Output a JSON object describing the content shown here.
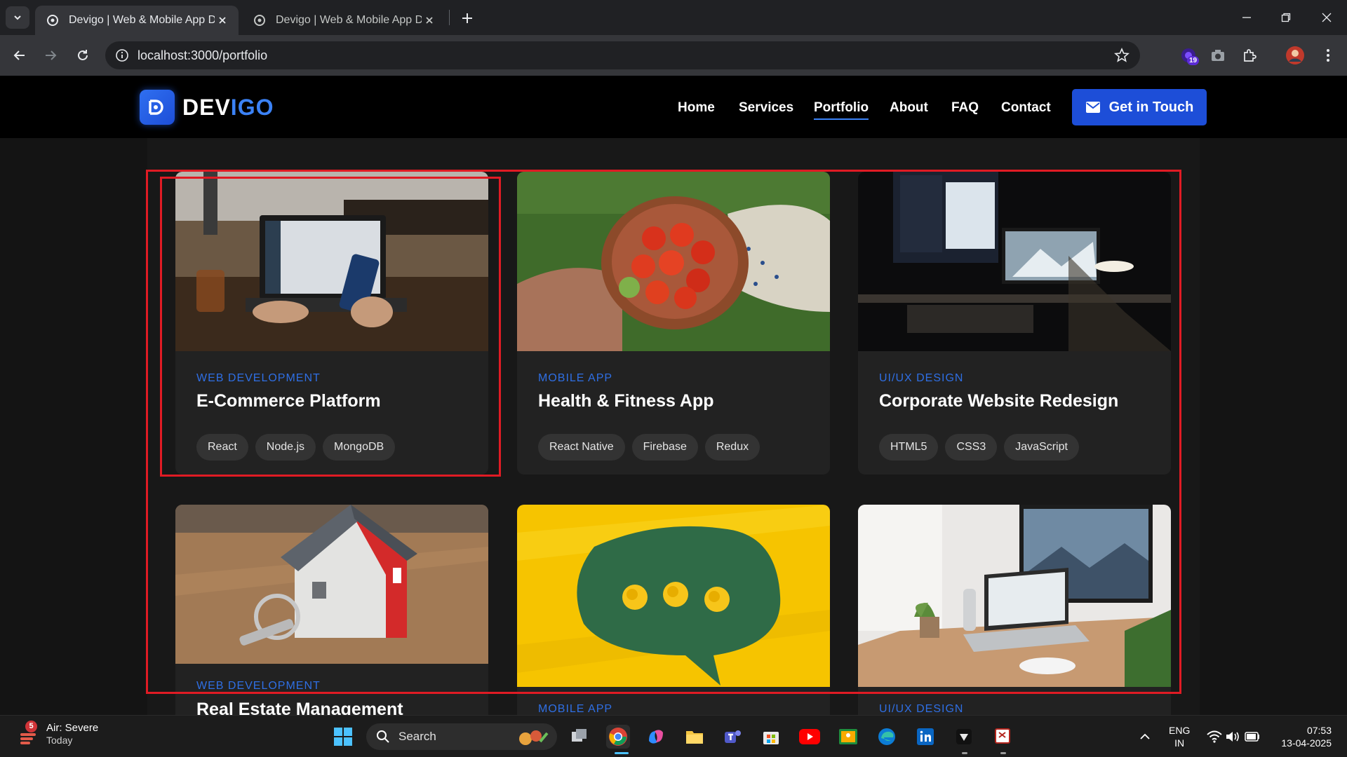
{
  "browser": {
    "tabs": [
      {
        "title": "Devigo | Web & Mobile App Development",
        "active": true
      },
      {
        "title": "Devigo | Web & Mobile App Development",
        "active": false
      }
    ],
    "url": "localhost:3000/portfolio",
    "extension_badge": "19"
  },
  "site": {
    "logo_prefix": "DEV",
    "logo_suffix": "IGO",
    "nav": [
      {
        "label": "Home",
        "active": false
      },
      {
        "label": "Services",
        "active": false
      },
      {
        "label": "Portfolio",
        "active": true
      },
      {
        "label": "About",
        "active": false
      },
      {
        "label": "FAQ",
        "active": false
      },
      {
        "label": "Contact",
        "active": false
      }
    ],
    "cta_label": "Get in Touch",
    "accent_color": "#1d4ed8",
    "category_color": "#2f6fe4"
  },
  "portfolio": [
    {
      "category": "WEB DEVELOPMENT",
      "title": "E-Commerce Platform",
      "tags": [
        "React",
        "Node.js",
        "MongoDB"
      ],
      "image": "laptop-and-phone-photo"
    },
    {
      "category": "MOBILE APP",
      "title": "Health & Fitness App",
      "tags": [
        "React Native",
        "Firebase",
        "Redux"
      ],
      "image": "tomato-bowl-photo"
    },
    {
      "category": "UI/UX DESIGN",
      "title": "Corporate Website Redesign",
      "tags": [
        "HTML5",
        "CSS3",
        "JavaScript"
      ],
      "image": "dark-desk-monitor-photo"
    },
    {
      "category": "WEB DEVELOPMENT",
      "title": "Real Estate Management",
      "tags": [],
      "image": "house-model-keys-photo"
    },
    {
      "category": "MOBILE APP",
      "title": "",
      "tags": [],
      "image": "speech-bubble-photo"
    },
    {
      "category": "UI/UX DESIGN",
      "title": "",
      "tags": [],
      "image": "bright-desk-laptop-photo"
    }
  ],
  "taskbar": {
    "weather_title": "Air: Severe",
    "weather_sub": "Today",
    "weather_badge": "5",
    "search_label": "Search",
    "lang_top": "ENG",
    "lang_bottom": "IN",
    "time": "07:53",
    "date": "13-04-2025"
  }
}
